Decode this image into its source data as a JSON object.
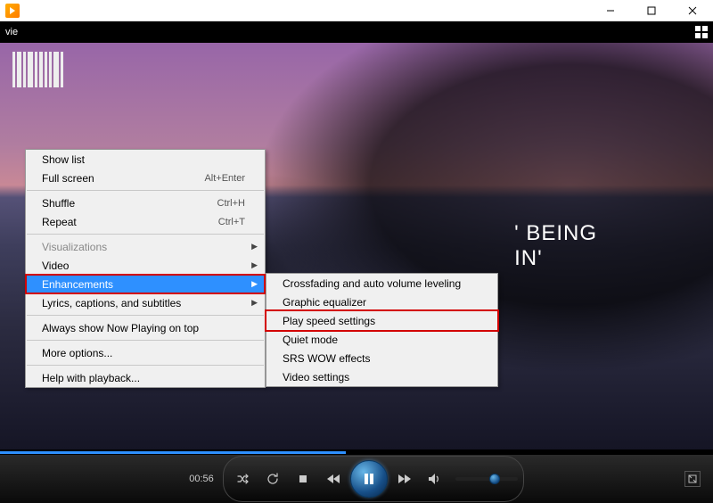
{
  "toolbar": {
    "mode_label": "vie"
  },
  "lyric": {
    "line1": "' BEING",
    "line2": "IN'"
  },
  "context_menu": {
    "items": [
      {
        "label": "Show list",
        "shortcut": "",
        "has_sub": false,
        "disabled": false
      },
      {
        "label": "Full screen",
        "shortcut": "Alt+Enter",
        "has_sub": false,
        "disabled": false
      },
      {
        "sep": true
      },
      {
        "label": "Shuffle",
        "shortcut": "Ctrl+H",
        "has_sub": false,
        "disabled": false
      },
      {
        "label": "Repeat",
        "shortcut": "Ctrl+T",
        "has_sub": false,
        "disabled": false
      },
      {
        "sep": true
      },
      {
        "label": "Visualizations",
        "shortcut": "",
        "has_sub": true,
        "disabled": true
      },
      {
        "label": "Video",
        "shortcut": "",
        "has_sub": true,
        "disabled": false
      },
      {
        "label": "Enhancements",
        "shortcut": "",
        "has_sub": true,
        "disabled": false,
        "selected": true,
        "red": true
      },
      {
        "label": "Lyrics, captions, and subtitles",
        "shortcut": "",
        "has_sub": true,
        "disabled": false
      },
      {
        "sep": true
      },
      {
        "label": "Always show Now Playing on top",
        "shortcut": "",
        "has_sub": false,
        "disabled": false
      },
      {
        "sep": true
      },
      {
        "label": "More options...",
        "shortcut": "",
        "has_sub": false,
        "disabled": false
      },
      {
        "sep": true
      },
      {
        "label": "Help with playback...",
        "shortcut": "",
        "has_sub": false,
        "disabled": false
      }
    ]
  },
  "submenu": {
    "items": [
      {
        "label": "Crossfading and auto volume leveling"
      },
      {
        "label": "Graphic equalizer"
      },
      {
        "label": "Play speed settings",
        "red": true
      },
      {
        "label": "Quiet mode"
      },
      {
        "label": "SRS WOW effects"
      },
      {
        "label": "Video settings"
      }
    ]
  },
  "playback": {
    "current_time": "00:56",
    "progress_percent": 48.5,
    "volume_percent": 55
  }
}
